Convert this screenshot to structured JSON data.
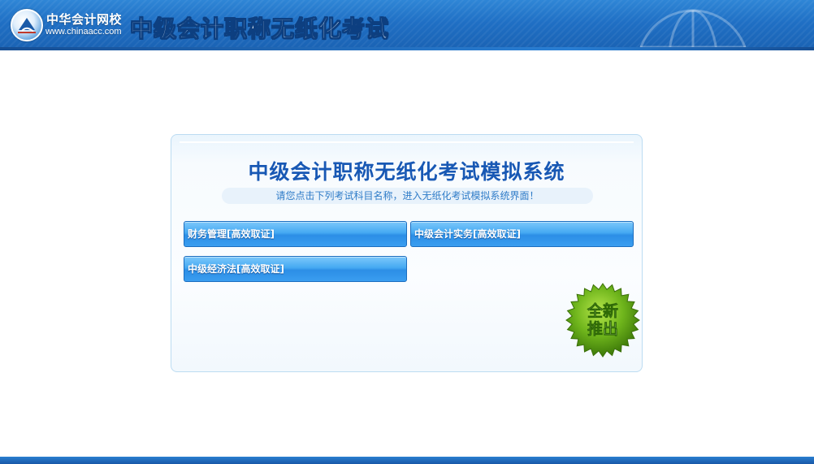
{
  "header": {
    "logo_name": "中华会计网校",
    "logo_url": "www.chinaacc.com",
    "title": "中级会计职称无纸化考试"
  },
  "panel": {
    "title": "中级会计职称无纸化考试模拟系统",
    "subtitle": "请您点击下列考试科目名称，进入无纸化考试模拟系统界面！",
    "subjects": [
      {
        "label": "财务管理[高效取证]"
      },
      {
        "label": "中级会计实务[高效取证]"
      },
      {
        "label": "中级经济法[高效取证]"
      }
    ],
    "badge": {
      "line1": "全新",
      "line2": "推出"
    }
  },
  "colors": {
    "header_blue": "#1f6fc4",
    "title_blue": "#1858b4",
    "button_blue": "#3a9ef0",
    "badge_green": "#5fa818"
  }
}
